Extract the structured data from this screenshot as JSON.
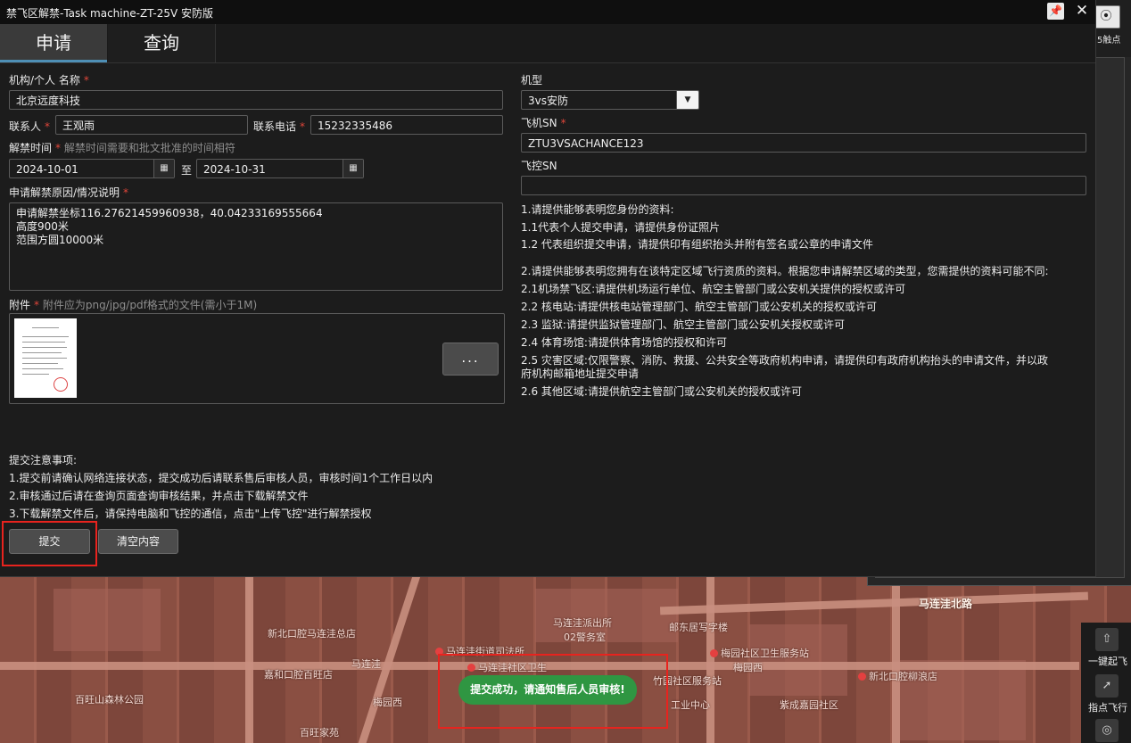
{
  "window": {
    "title": "禁飞区解禁-Task machine-ZT-25V 安防版"
  },
  "tabs": [
    {
      "label": "申请"
    },
    {
      "label": "查询"
    }
  ],
  "form": {
    "org_label": "机构/个人 名称",
    "org_value": "北京远度科技",
    "contact_label": "联系人",
    "contact_value": "王观雨",
    "phone_label": "联系电话",
    "phone_value": "15232335486",
    "time_label": "解禁时间",
    "time_hint": "解禁时间需要和批文批准的时间相符",
    "date_from": "2024-10-01",
    "date_sep": "至",
    "date_to": "2024-10-31",
    "reason_label": "申请解禁原因/情况说明",
    "reason_lines": [
      "申请解禁坐标116.27621459960938，40.04233169555664",
      "高度900米",
      "范围方圆10000米"
    ],
    "attach_label": "附件",
    "attach_hint": "附件应为png/jpg/pdf格式的文件(需小于1M)",
    "more_label": "...",
    "model_label": "机型",
    "model_value": "3vs安防",
    "sn_label": "飞机SN",
    "sn_value": "ZTU3VSACHANCE123",
    "fc_label": "飞控SN",
    "fc_value": ""
  },
  "requirements": [
    "1.请提供能够表明您身份的资料:",
    "1.1代表个人提交申请，请提供身份证照片",
    "1.2 代表组织提交申请，请提供印有组织抬头并附有签名或公章的申请文件",
    "2.请提供能够表明您拥有在该特定区域飞行资质的资料。根据您申请解禁区域的类型，您需提供的资料可能不同:",
    "2.1机场禁飞区:请提供机场运行单位、航空主管部门或公安机关提供的授权或许可",
    "2.2 核电站:请提供核电站管理部门、航空主管部门或公安机关的授权或许可",
    "2.3 监狱:请提供监狱管理部门、航空主管部门或公安机关授权或许可",
    "2.4 体育场馆:请提供体育场馆的授权和许可",
    "2.5 灾害区域:仅限警察、消防、救援、公共安全等政府机构申请，请提供印有政府机构抬头的申请文件，并以政",
    "府机构邮箱地址提交申请",
    "2.6 其他区域:请提供航空主管部门或公安机关的授权或许可"
  ],
  "notes": {
    "title": "提交注意事项:",
    "lines": [
      "1.提交前请确认网络连接状态，提交成功后请联系售后审核人员，审核时间1个工作日以内",
      "2.审核通过后请在查询页面查询审核结果，并点击下载解禁文件",
      "3.下载解禁文件后，请保持电脑和飞控的通信，点击\"上传飞控\"进行解禁授权"
    ]
  },
  "buttons": {
    "submit": "提交",
    "clear": "清空内容"
  },
  "toast": {
    "text": "提交成功，请通知售后人员审核!"
  },
  "side": {
    "top_label": "5触点",
    "tool1": "一键起飞",
    "tool2": "指点飞行"
  },
  "map_labels": {
    "road": "马连洼北路",
    "l1": "马连洼派出所",
    "l2": "02警务室",
    "l3": "新北口腔马连洼总店",
    "l4": "马连洼街道司法所",
    "l5": "马连洼社区卫生",
    "l6": "马连洼",
    "l7": "嘉和口腔百旺店",
    "l8": "梅园西",
    "l9": "百旺山森林公园",
    "l10": "百旺家苑",
    "l11": "梅园社区卫生服务站",
    "l12": "新北口腔柳浪店",
    "l13": "紫成嘉园社区",
    "l14": "竹园社区服务站",
    "l15": "工业中心",
    "l16": "邮东居写字楼",
    "l17": "梅园西"
  },
  "colors": {
    "accent_tab": "#4e8fb5",
    "highlight": "#e8231e",
    "toast": "#2f9642",
    "required": "#e0463a"
  }
}
